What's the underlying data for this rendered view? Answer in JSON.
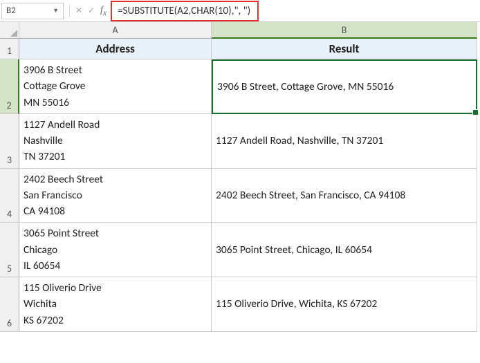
{
  "name_box": "B2",
  "formula": "=SUBSTITUTE(A2,CHAR(10),\", \")",
  "columns": [
    "A",
    "B"
  ],
  "headers": {
    "a": "Address",
    "b": "Result"
  },
  "rows": [
    {
      "num": "1"
    },
    {
      "num": "2",
      "address": "3906 B Street\nCottage Grove\nMN 55016",
      "result": "3906 B Street, Cottage Grove, MN 55016"
    },
    {
      "num": "3",
      "address": "1127 Andell Road\nNashville\nTN 37201",
      "result": "1127 Andell Road, Nashville, TN 37201"
    },
    {
      "num": "4",
      "address": "2402 Beech Street\nSan Francisco\nCA 94108",
      "result": "2402 Beech Street, San Francisco, CA 94108"
    },
    {
      "num": "5",
      "address": "3065 Point Street\nChicago\nIL 60654",
      "result": "3065 Point Street, Chicago, IL 60654"
    },
    {
      "num": "6",
      "address": "115 Oliverio Drive\nWichita\nKS 67202",
      "result": "115 Oliverio Drive, Wichita, KS 67202"
    }
  ],
  "selected_cell": "B2"
}
